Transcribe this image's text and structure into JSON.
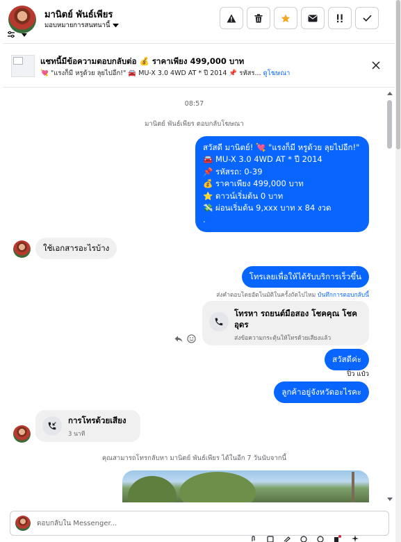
{
  "header": {
    "contact_name": "มานิตย์ พันธ์เพียร",
    "assign_label": "มอบหมายการสนทนานี้",
    "toolbar": [
      {
        "name": "spam-button",
        "icon": "warning-icon"
      },
      {
        "name": "delete-button",
        "icon": "trash-icon"
      },
      {
        "name": "star-button",
        "icon": "star-icon"
      },
      {
        "name": "mark-unread-button",
        "icon": "envelope-icon"
      },
      {
        "name": "follow-up-button",
        "icon": "exclamation-icon"
      },
      {
        "name": "done-button",
        "icon": "check-icon"
      }
    ]
  },
  "ad": {
    "title": "แชทนี้มีข้อความตอบกลับต่อ 💰 ราคาเพียง 499,000 บาท",
    "subtitle": "💘 \"แรงก็มี หรูด้วย ลุยไปอีก!\" 🚘 MU-X 3.0 4WD AT * ปี 2014 📌 รหัสร...",
    "link_label": "ดูโฆษณา"
  },
  "chat": {
    "time": "08:57",
    "ad_reply_note": "มานิตย์ พันธ์เพียร ตอบกลับโฆษณา",
    "ad_message_lines": [
      "สวัสดี มานิตย์! 💘 \"แรงก็มี หรูด้วย ลุยไปอีก!\"",
      "🚘 MU-X 3.0 4WD AT * ปี 2014",
      "📌 รหัสรถ: 0-39",
      "💰 ราคาเพียง 499,000 บาท",
      "⭐ ดาวน์เริ่มต้น 0 บาท",
      "💸 ผ่อนเริ่มต้น 9,xxx บาท x 84 งวด",
      "."
    ],
    "incoming_1": "ใช้เอกสารอะไรบ้าง",
    "outgoing_call_prompt": "โทรเลยเพื่อให้ได้รับบริการเร็วขึ้น",
    "auto_note": "ส่งคำตอบโดยอัตโนมัติในครั้งถัดไปไหม",
    "auto_note_link": "บันทึกการตอบกลับนี้",
    "call_card_title": "โทรหา รถยนต์มือสอง โชคคุณ โชค อุดร",
    "call_card_sub": "ส่งข้อความกระตุ้นให้โทรด้วยเสียงแล้ว",
    "outgoing_hello": "สวัสดีค่ะ",
    "seen_by": "ปิ๋ว แป๋ว",
    "outgoing_province": "ลูกค้าอยู่จังหวัดอะไรคะ",
    "voice_call_title": "การโทรด้วยเสียง",
    "voice_call_duration": "3 นาที",
    "callback_note": "คุณสามารถโทรกลับหา มานิตย์ พันธ์เพียร ได้ในอีก 7 วันนับจากนี้"
  },
  "composer": {
    "placeholder": "ตอบกลับใน Messenger..."
  },
  "colors": {
    "accent": "#0866ff",
    "bubble_in": "#f0f0f0",
    "star": "#f5a623"
  }
}
